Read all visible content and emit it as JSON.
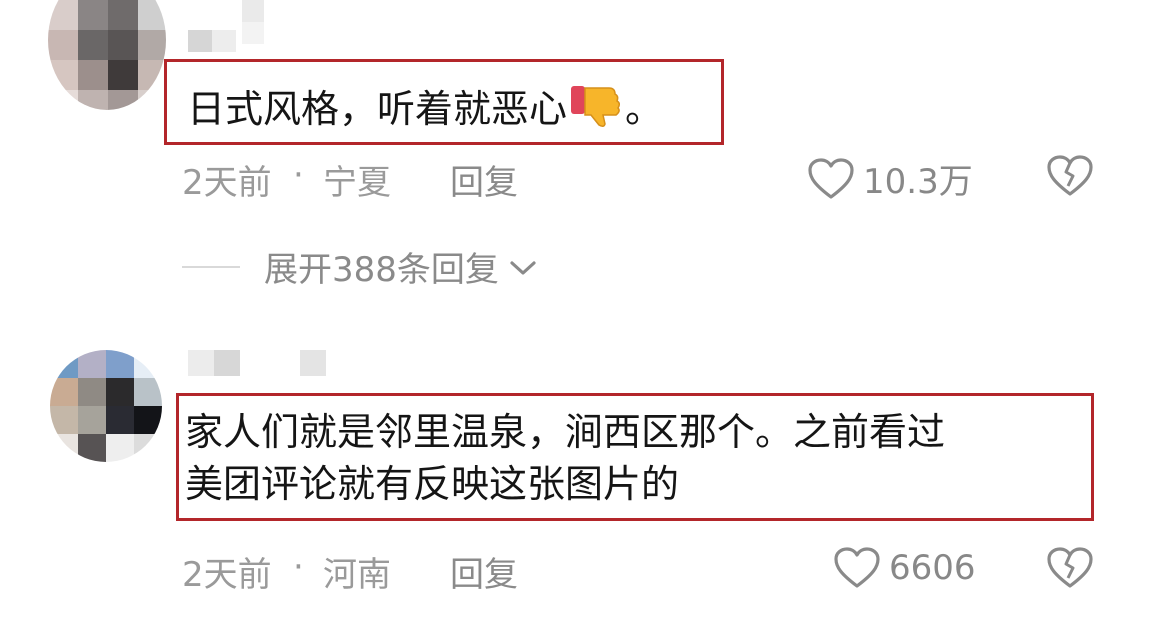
{
  "comments": [
    {
      "text_lines": [
        "日式风格，听着就恶心"
      ],
      "emoji_tail": "。",
      "time": "2天前",
      "sep": "·",
      "location": "宁夏",
      "reply_label": "回复",
      "like_count": "10.3万",
      "expand_label": "展开388条回复",
      "icons": {
        "like": "heart-outline-icon",
        "dislike": "broken-heart-icon",
        "emoji": "thumbs-down-emoji",
        "expand": "chevron-down-icon"
      }
    },
    {
      "text_lines": [
        "家人们就是邻里温泉，涧西区那个。之前看过",
        "美团评论就有反映这张图片的"
      ],
      "time": "2天前",
      "sep": "·",
      "location": "河南",
      "reply_label": "回复",
      "like_count": "6606",
      "icons": {
        "like": "heart-outline-icon",
        "dislike": "broken-heart-icon"
      }
    }
  ],
  "colors": {
    "highlight_border": "#b3262a",
    "text": "#151515",
    "meta": "#9a9a9a"
  }
}
